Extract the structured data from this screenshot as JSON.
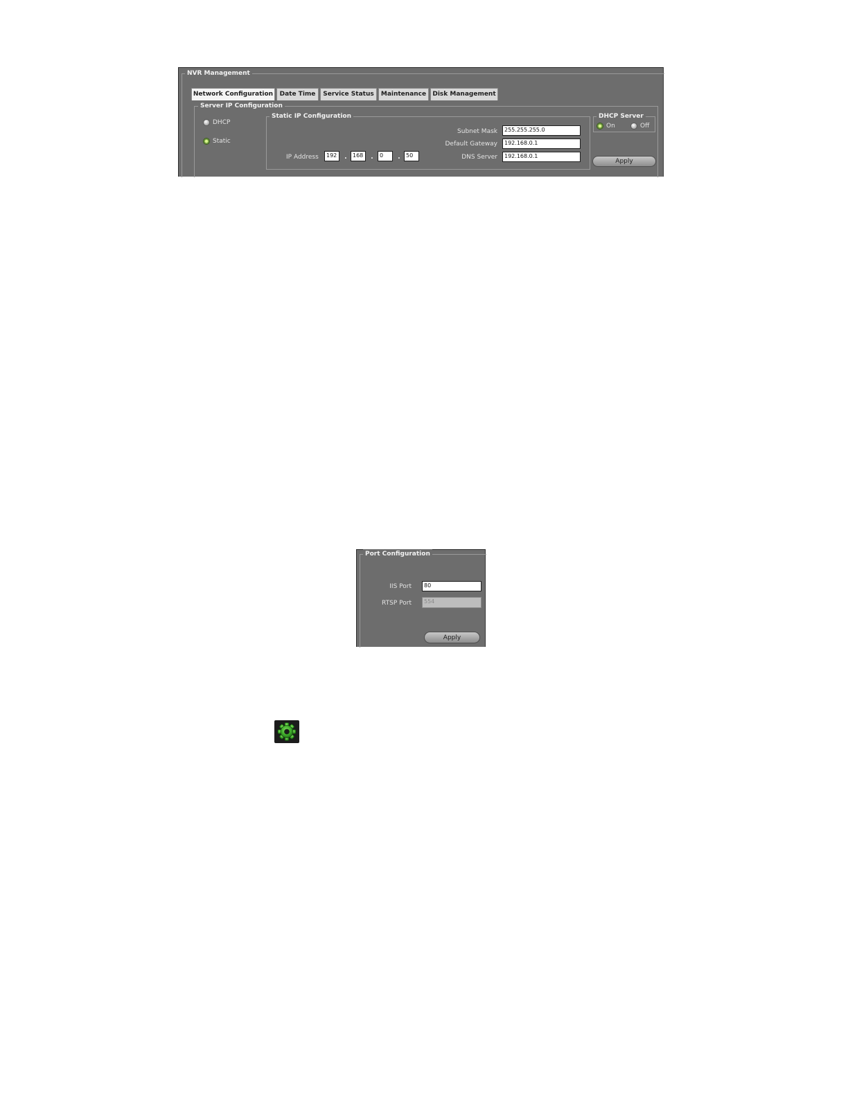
{
  "nvr": {
    "title": "NVR Management",
    "tabs": [
      {
        "label": "Network Configuration",
        "active": true
      },
      {
        "label": "Date Time",
        "active": false
      },
      {
        "label": "Service Status",
        "active": false
      },
      {
        "label": "Maintenance",
        "active": false
      },
      {
        "label": "Disk Management",
        "active": false
      }
    ],
    "server_ip": {
      "title": "Server IP Configuration",
      "mode_options": [
        {
          "label": "DHCP",
          "selected": false
        },
        {
          "label": "Static",
          "selected": true
        }
      ],
      "static": {
        "title": "Static IP Configuration",
        "subnet_label": "Subnet Mask",
        "subnet_value": "255.255.255.0",
        "gateway_label": "Default Gateway",
        "gateway_value": "192.168.0.1",
        "dns_label": "DNS Server",
        "dns_value": "192.168.0.1",
        "ip_label": "IP Address",
        "ip_octets": [
          "192",
          "168",
          "0",
          "50"
        ],
        "separator": "."
      },
      "dhcp_server": {
        "title": "DHCP Server",
        "on_label": "On",
        "off_label": "Off",
        "selected": "on"
      },
      "apply_label": "Apply"
    }
  },
  "port": {
    "title": "Port Configuration",
    "iis_label": "IIS Port",
    "iis_value": "80",
    "rtsp_label": "RTSP Port",
    "rtsp_value": "554",
    "apply_label": "Apply"
  },
  "settings_icon": {
    "name": "gear-icon",
    "color": "#3fae2a"
  }
}
